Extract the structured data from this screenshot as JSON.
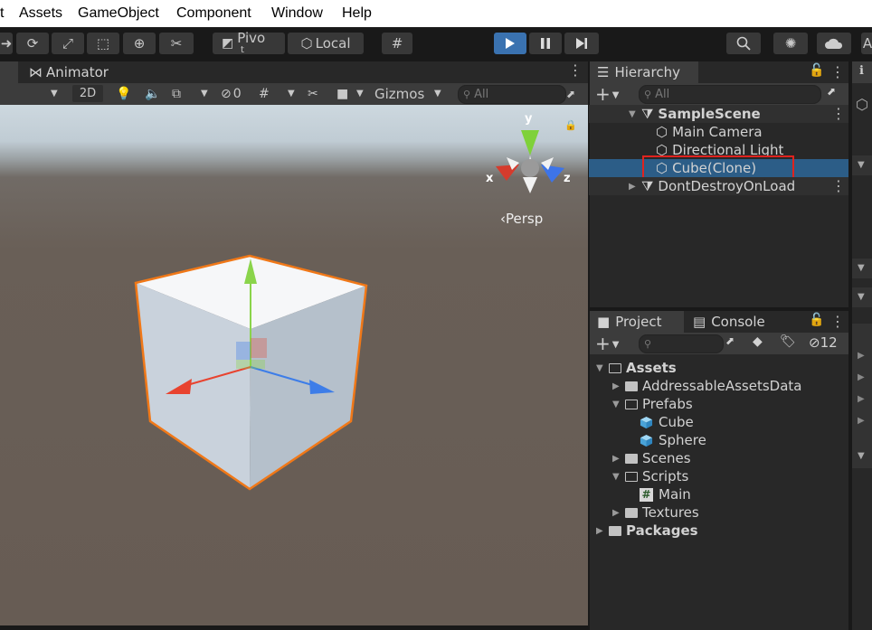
{
  "menu": [
    "t",
    "Assets",
    "GameObject",
    "Component",
    "Window",
    "Help"
  ],
  "toolbar": {
    "pivot_label": "Pivo",
    "pivot_sub": "t",
    "local_label": "Local"
  },
  "scene_panel": {
    "tab_animator": "Animator",
    "mode_2d": "2D",
    "hidden_count": "0",
    "gizmos_label": "Gizmos",
    "search_placeholder": "All",
    "gizmo_axes": {
      "x": "x",
      "y": "y",
      "z": "z"
    },
    "projection_label": "‹Persp"
  },
  "hierarchy": {
    "tab_label": "Hierarchy",
    "search_placeholder": "All",
    "items": [
      {
        "label": "SampleScene",
        "type": "scene"
      },
      {
        "label": "Main Camera",
        "type": "object"
      },
      {
        "label": "Directional Light",
        "type": "object"
      },
      {
        "label": "Cube(Clone)",
        "type": "object",
        "selected": true
      },
      {
        "label": "DontDestroyOnLoad",
        "type": "scene"
      }
    ]
  },
  "project": {
    "tab_project": "Project",
    "tab_console": "Console",
    "hidden_count": "12",
    "tree": [
      {
        "label": "Assets"
      },
      {
        "label": "AddressableAssetsData"
      },
      {
        "label": "Prefabs"
      },
      {
        "label": "Cube"
      },
      {
        "label": "Sphere"
      },
      {
        "label": "Scenes"
      },
      {
        "label": "Scripts"
      },
      {
        "label": "Main"
      },
      {
        "label": "Textures"
      },
      {
        "label": "Packages"
      }
    ]
  },
  "inspector_tab_letter": "A",
  "colors": {
    "selection": "#2c5d87",
    "highlight_box": "#e0231e",
    "cube_outline": "#f07818",
    "play_button": "#3a72b0"
  }
}
